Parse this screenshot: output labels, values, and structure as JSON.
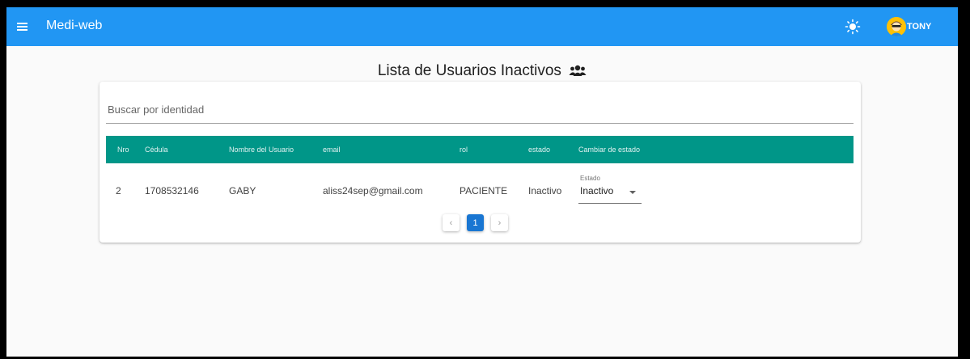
{
  "appbar": {
    "title": "Medi-web",
    "user_name": "TONY",
    "icons": {
      "menu": "menu-icon",
      "theme": "sun-icon",
      "avatar": "avatar-icon"
    },
    "color": "#2196f3"
  },
  "page": {
    "title": "Lista de Usuarios Inactivos",
    "title_icon": "users-icon"
  },
  "search": {
    "placeholder": "Buscar por identidad",
    "value": ""
  },
  "table": {
    "header_color": "#009688",
    "columns": [
      "Nro",
      "Cédula",
      "Nombre del Usuario",
      "email",
      "rol",
      "estado",
      "Cambiar de estado"
    ],
    "rows": [
      {
        "nro": "2",
        "cedula": "1708532146",
        "nombre": "GABY",
        "email": "aliss24sep@gmail.com",
        "rol": "PACIENTE",
        "estado": "Inactivo",
        "cambiar": {
          "label": "Estado",
          "value": "Inactivo"
        }
      }
    ]
  },
  "pagination": {
    "prev": "‹",
    "current": "1",
    "next": "›",
    "active_color": "#1976d2"
  }
}
